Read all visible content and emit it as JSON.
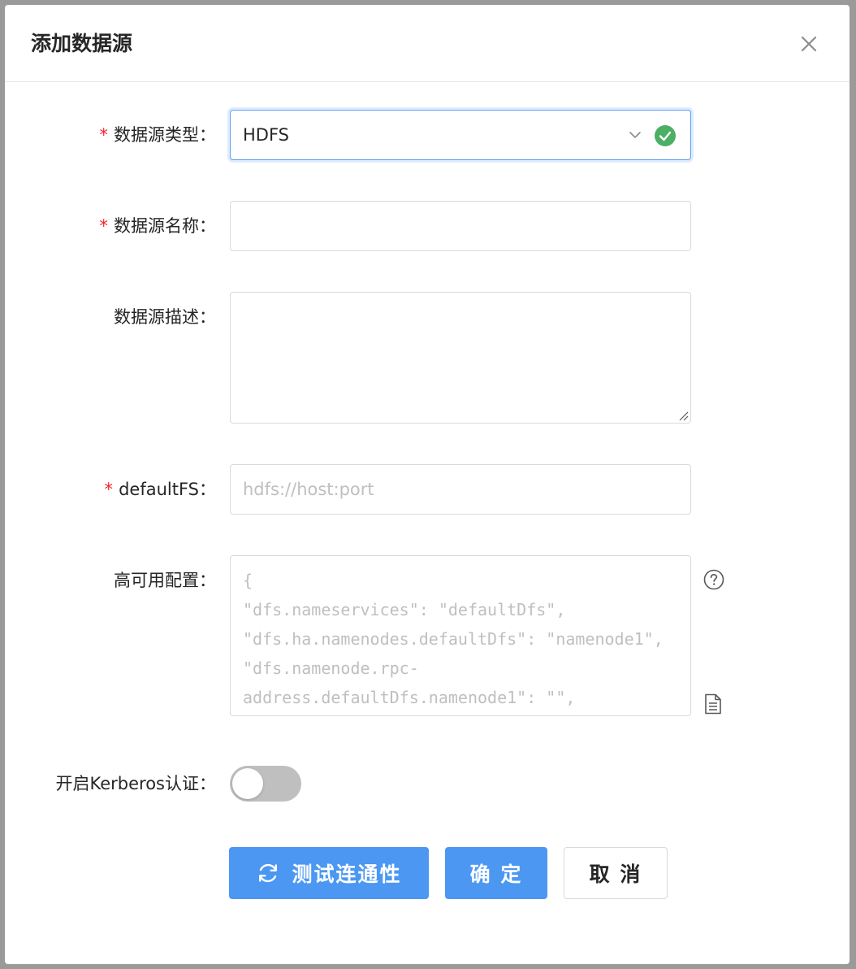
{
  "dialog": {
    "title": "添加数据源",
    "close_icon": "close-icon"
  },
  "form": {
    "type": {
      "required_mark": "*",
      "label": "数据源类型：",
      "value": "HDFS",
      "status": "valid",
      "status_color": "#52c41a"
    },
    "name": {
      "required_mark": "*",
      "label": "数据源名称：",
      "value": ""
    },
    "description": {
      "label": "数据源描述：",
      "value": ""
    },
    "default_fs": {
      "required_mark": "*",
      "label": "defaultFS：",
      "placeholder": "hdfs://host:port"
    },
    "ha_config": {
      "label": "高可用配置：",
      "placeholder": "{\n\"dfs.nameservices\": \"defaultDfs\",\n\"dfs.ha.namenodes.defaultDfs\": \"namenode1\",\n\"dfs.namenode.rpc-\naddress.defaultDfs.namenode1\": \"\","
    },
    "kerberos": {
      "label": "开启Kerberos认证：",
      "enabled": false
    }
  },
  "buttons": {
    "test": "测试连通性",
    "ok": "确 定",
    "cancel": "取 消"
  },
  "colors": {
    "primary": "#4b97f2",
    "required": "#f5222d",
    "success": "#52c41a"
  }
}
